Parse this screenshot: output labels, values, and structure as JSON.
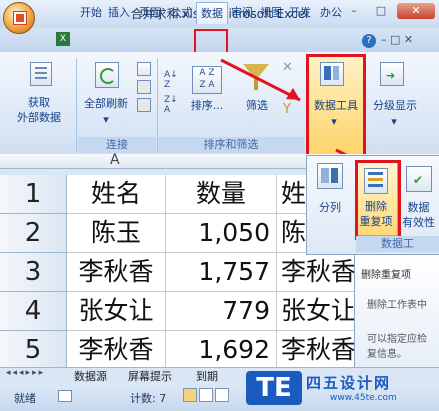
{
  "window": {
    "title": "合并求和.xlsx - Microsoft Excel",
    "minimize": "–",
    "maximize": "□",
    "close": "✕"
  },
  "tabs": [
    {
      "label": "开始"
    },
    {
      "label": "插入"
    },
    {
      "label": "页面"
    },
    {
      "label": "公式"
    },
    {
      "label": "数据",
      "active": true
    },
    {
      "label": "审阅"
    },
    {
      "label": "视图"
    },
    {
      "label": "开发"
    },
    {
      "label": "办公"
    }
  ],
  "ribbon": {
    "get_external": "获取\n外部数据",
    "refresh_all": "全部刷新",
    "group_connections": "连接",
    "sort": "排序...",
    "filter": "筛选",
    "group_sort_filter": "排序和筛选",
    "data_tools": "数据工具",
    "outline": "分级显示"
  },
  "colstrip_letter": "A",
  "rows": [
    {
      "num": "1",
      "name": "姓名",
      "qty": "数量",
      "c": "姓"
    },
    {
      "num": "2",
      "name": "陈玉",
      "qty": "1,050",
      "c": "陈"
    },
    {
      "num": "3",
      "name": "李秋香",
      "qty": "1,757",
      "c": "李秋香"
    },
    {
      "num": "4",
      "name": "张女让",
      "qty": "779",
      "c": "张女让"
    },
    {
      "num": "5",
      "name": "李秋香",
      "qty": "1,692",
      "c": "李秋香"
    }
  ],
  "datatools_panel": {
    "split": "分列",
    "remove_dup": "删除\n重复项",
    "validation": "数据\n有效性",
    "group_label": "数据工"
  },
  "tooltip": {
    "title": "删除重复项",
    "line1": "删除工作表中",
    "line2": "可以指定应检",
    "line3": "复信息。"
  },
  "sheets": [
    "数据源",
    "屏幕提示",
    "到期"
  ],
  "status": {
    "ready": "就绪",
    "count": "计数: 7"
  },
  "watermark": {
    "logo": "TE",
    "site_cn": "四五设计网",
    "site_url": "www.45te.com"
  },
  "colors": {
    "highlight_red": "#e0141e",
    "ribbon_blue": "#15428b",
    "watermark_blue": "#1a5bbf"
  }
}
